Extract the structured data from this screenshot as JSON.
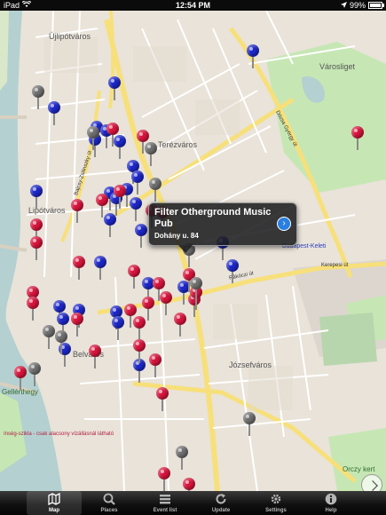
{
  "status_bar": {
    "device": "iPad",
    "time": "12:54 PM",
    "battery": "99%",
    "battery_level": 0.99
  },
  "map": {
    "labels": {
      "ujlipotvaros": "Újlipótváros",
      "terezvaros": "Terézváros",
      "lipotvaros": "Lipótváros",
      "varosliget": "Városliget",
      "jozsefvaros": "Józsefváros",
      "belvaros": "Belváros",
      "keleti": "Budapest-Keleti",
      "kerepesi_ut": "Kerepesi út",
      "rakoczi_ut": "Rákóczi út",
      "dozsa": "Dózsa György út",
      "bajcsy": "Bajcsy-Zsilinszky út",
      "orczy": "Orczy kert",
      "gellert": "Gellérthegy",
      "hint": "ínség-szikla - csak alacsony vízállásnál látható"
    },
    "pins": [
      {
        "color": "blue"
      },
      {
        "color": "blue"
      },
      {
        "color": "blue"
      },
      {
        "color": "blue"
      },
      {
        "color": "blue"
      },
      {
        "color": "blue"
      },
      {
        "color": "blue"
      },
      {
        "color": "blue"
      },
      {
        "color": "blue"
      },
      {
        "color": "blue"
      },
      {
        "color": "blue"
      },
      {
        "color": "blue"
      },
      {
        "color": "blue"
      },
      {
        "color": "blue"
      },
      {
        "color": "blue"
      },
      {
        "color": "blue"
      },
      {
        "color": "blue"
      },
      {
        "color": "blue"
      },
      {
        "color": "blue"
      },
      {
        "color": "blue"
      },
      {
        "color": "blue"
      },
      {
        "color": "blue"
      },
      {
        "color": "blue"
      },
      {
        "color": "blue"
      },
      {
        "color": "blue"
      },
      {
        "color": "blue"
      },
      {
        "color": "blue"
      },
      {
        "color": "blue"
      },
      {
        "color": "red"
      },
      {
        "color": "red"
      },
      {
        "color": "red"
      },
      {
        "color": "red"
      },
      {
        "color": "red"
      },
      {
        "color": "red"
      },
      {
        "color": "red"
      },
      {
        "color": "red"
      },
      {
        "color": "red"
      },
      {
        "color": "red"
      },
      {
        "color": "red"
      },
      {
        "color": "red"
      },
      {
        "color": "red"
      },
      {
        "color": "red"
      },
      {
        "color": "red"
      },
      {
        "color": "red"
      },
      {
        "color": "red"
      },
      {
        "color": "red"
      },
      {
        "color": "red"
      },
      {
        "color": "red"
      },
      {
        "color": "red"
      },
      {
        "color": "red"
      },
      {
        "color": "red"
      },
      {
        "color": "red"
      },
      {
        "color": "red"
      },
      {
        "color": "red"
      },
      {
        "color": "red"
      },
      {
        "color": "red"
      },
      {
        "color": "red"
      },
      {
        "color": "red"
      },
      {
        "color": "red"
      },
      {
        "color": "gray"
      },
      {
        "color": "gray"
      },
      {
        "color": "gray"
      },
      {
        "color": "gray"
      },
      {
        "color": "gray"
      },
      {
        "color": "gray"
      },
      {
        "color": "gray"
      },
      {
        "color": "gray"
      },
      {
        "color": "gray"
      },
      {
        "color": "gray"
      },
      {
        "color": "gray"
      }
    ]
  },
  "callout": {
    "title": "Filter Otherground Music Pub",
    "subtitle": "Dohány u. 84",
    "disclosure": "›"
  },
  "tabs": [
    {
      "label": "Map",
      "icon": "map-icon",
      "active": true
    },
    {
      "label": "Places",
      "icon": "search-icon",
      "active": false
    },
    {
      "label": "Event list",
      "icon": "list-icon",
      "active": false
    },
    {
      "label": "Update",
      "icon": "refresh-icon",
      "active": false
    },
    {
      "label": "Settings",
      "icon": "gear-icon",
      "active": false
    },
    {
      "label": "Help",
      "icon": "info-icon",
      "active": false
    }
  ],
  "colors": {
    "pin_blue": "#1d27c9",
    "pin_red": "#d8143c",
    "pin_gray": "#6f6f6f",
    "river": "#b5d0d0",
    "park": "#c6e7b4",
    "road_major": "#f7e07a"
  }
}
